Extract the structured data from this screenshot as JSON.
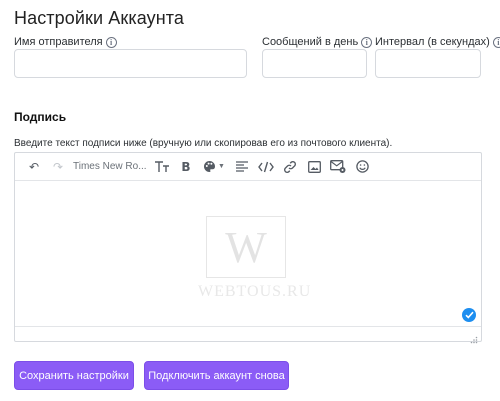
{
  "page": {
    "title": "Настройки Аккаунта"
  },
  "fields": {
    "sender_name": {
      "label": "Имя отправителя",
      "value": ""
    },
    "messages_per_day": {
      "label": "Сообщений в день",
      "value": ""
    },
    "interval": {
      "label": "Интервал (в секундах)",
      "value": ""
    }
  },
  "signature": {
    "title": "Подпись",
    "hint": "Введите текст подписи ниже (вручную или скопировав его из почтового клиента).",
    "toolbar": {
      "undo": "↶",
      "redo": "↷",
      "font_family": "Times New Ro...",
      "font_size": "T",
      "bold": "B"
    },
    "watermark": {
      "letter": "W",
      "text": "WEBTOUS.RU"
    }
  },
  "buttons": {
    "save": "Сохранить настройки",
    "reconnect": "Подключить аккаунт снова"
  },
  "colors": {
    "accent": "#8b5cf6",
    "check": "#1d8ef0"
  }
}
